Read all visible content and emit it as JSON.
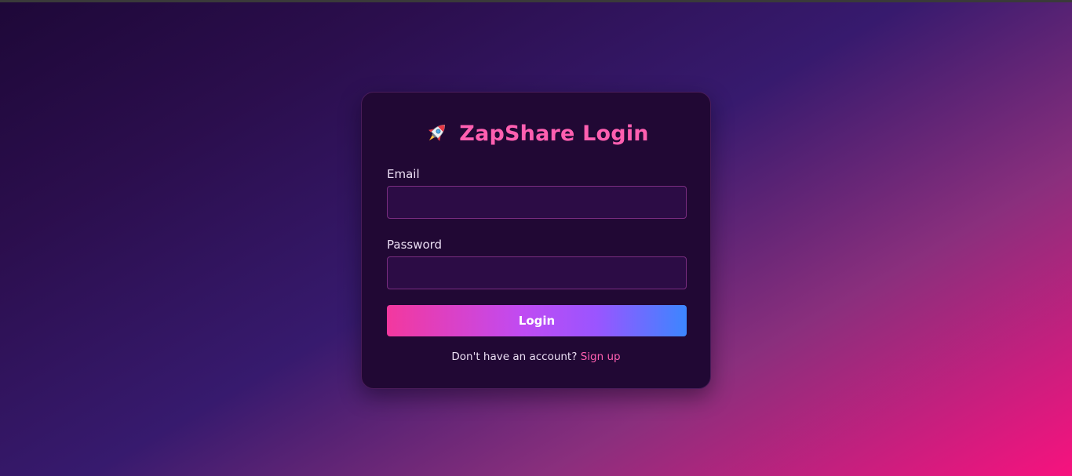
{
  "login_card": {
    "title": "ZapShare Login",
    "title_icon": "rocket-icon",
    "email_label": "Email",
    "email_value": "",
    "password_label": "Password",
    "password_value": "",
    "login_button_label": "Login",
    "signup_prompt": "Don't have an account?",
    "signup_link_label": "Sign up"
  },
  "colors": {
    "accent_pink": "#ff5fb0",
    "card_background": "#210834",
    "button_gradient_start": "#f3389e",
    "button_gradient_end": "#3c86ff"
  }
}
